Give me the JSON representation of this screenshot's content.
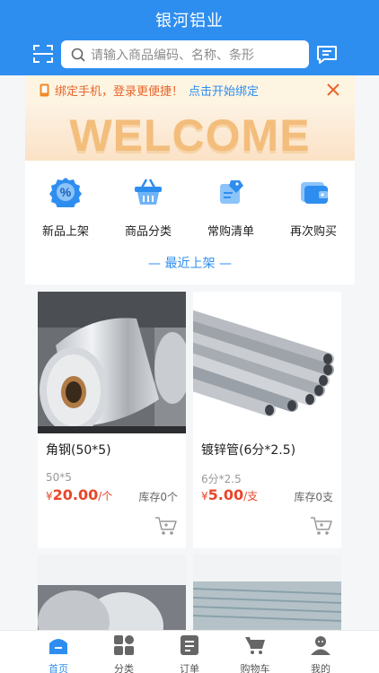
{
  "app_title": "银河铝业",
  "search": {
    "placeholder": "请输入商品编码、名称、条形"
  },
  "bind_bar": {
    "tip": "绑定手机，登录更便捷！",
    "link": "点击开始绑定"
  },
  "banner": {
    "text": "WELCOME"
  },
  "quick_menu": [
    {
      "label": "新品上架",
      "icon": "percent-badge-icon"
    },
    {
      "label": "商品分类",
      "icon": "basket-icon"
    },
    {
      "label": "常购清单",
      "icon": "list-tag-icon"
    },
    {
      "label": "再次购买",
      "icon": "wallet-icon"
    }
  ],
  "section_title": "— 最近上架 —",
  "products": [
    {
      "name": "角钢(50*5)",
      "spec": "50*5",
      "currency": "¥",
      "price": "20.00",
      "unit": "/个",
      "stock": "库存0个"
    },
    {
      "name": "镀锌管(6分*2.5)",
      "spec": "6分*2.5",
      "currency": "¥",
      "price": "5.00",
      "unit": "/支",
      "stock": "库存0支"
    }
  ],
  "tabs": [
    {
      "label": "首页",
      "icon": "home-icon",
      "active": true
    },
    {
      "label": "分类",
      "icon": "category-grid-icon"
    },
    {
      "label": "订单",
      "icon": "order-list-icon"
    },
    {
      "label": "购物车",
      "icon": "cart-icon"
    },
    {
      "label": "我的",
      "icon": "user-icon"
    }
  ],
  "colors": {
    "primary": "#2e8ef0",
    "price": "#e8462b",
    "warning": "#e8662b"
  }
}
